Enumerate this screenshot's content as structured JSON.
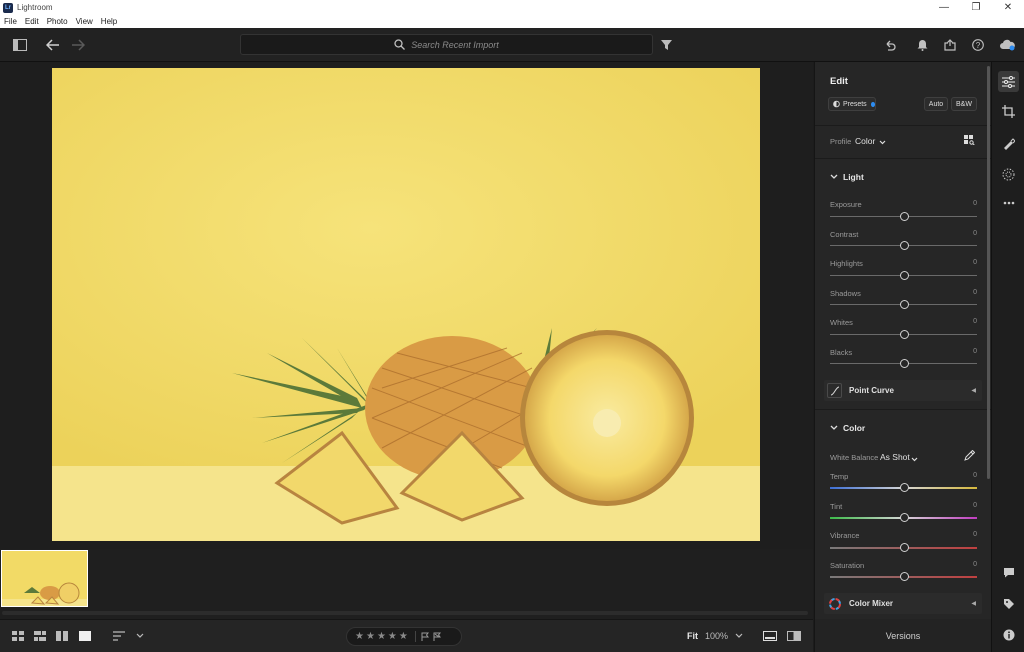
{
  "window": {
    "title": "Lightroom",
    "app_icon_text": "Lr",
    "controls": [
      "—",
      "❐",
      "✕"
    ]
  },
  "menu": [
    "File",
    "Edit",
    "Photo",
    "View",
    "Help"
  ],
  "toolbar": {
    "search_placeholder": "Search Recent Import"
  },
  "edit": {
    "title": "Edit",
    "presets_label": "Presets",
    "auto_label": "Auto",
    "bw_label": "B&W",
    "profile_label": "Profile",
    "profile_value": "Color",
    "light": {
      "title": "Light",
      "sliders": [
        {
          "label": "Exposure",
          "value": "0"
        },
        {
          "label": "Contrast",
          "value": "0"
        },
        {
          "label": "Highlights",
          "value": "0"
        },
        {
          "label": "Shadows",
          "value": "0"
        },
        {
          "label": "Whites",
          "value": "0"
        },
        {
          "label": "Blacks",
          "value": "0"
        }
      ]
    },
    "point_curve_label": "Point Curve",
    "color": {
      "title": "Color",
      "wb_label": "White Balance",
      "wb_value": "As Shot",
      "sliders": [
        {
          "label": "Temp",
          "value": "0"
        },
        {
          "label": "Tint",
          "value": "0"
        },
        {
          "label": "Vibrance",
          "value": "0"
        },
        {
          "label": "Saturation",
          "value": "0"
        }
      ]
    },
    "color_mixer_label": "Color Mixer"
  },
  "bottom": {
    "fit_label": "Fit",
    "zoom_value": "100%",
    "versions_label": "Versions",
    "stars": 0
  },
  "colors": {
    "accent_blue": "#2d8cf0",
    "panel_bg": "#262626"
  }
}
